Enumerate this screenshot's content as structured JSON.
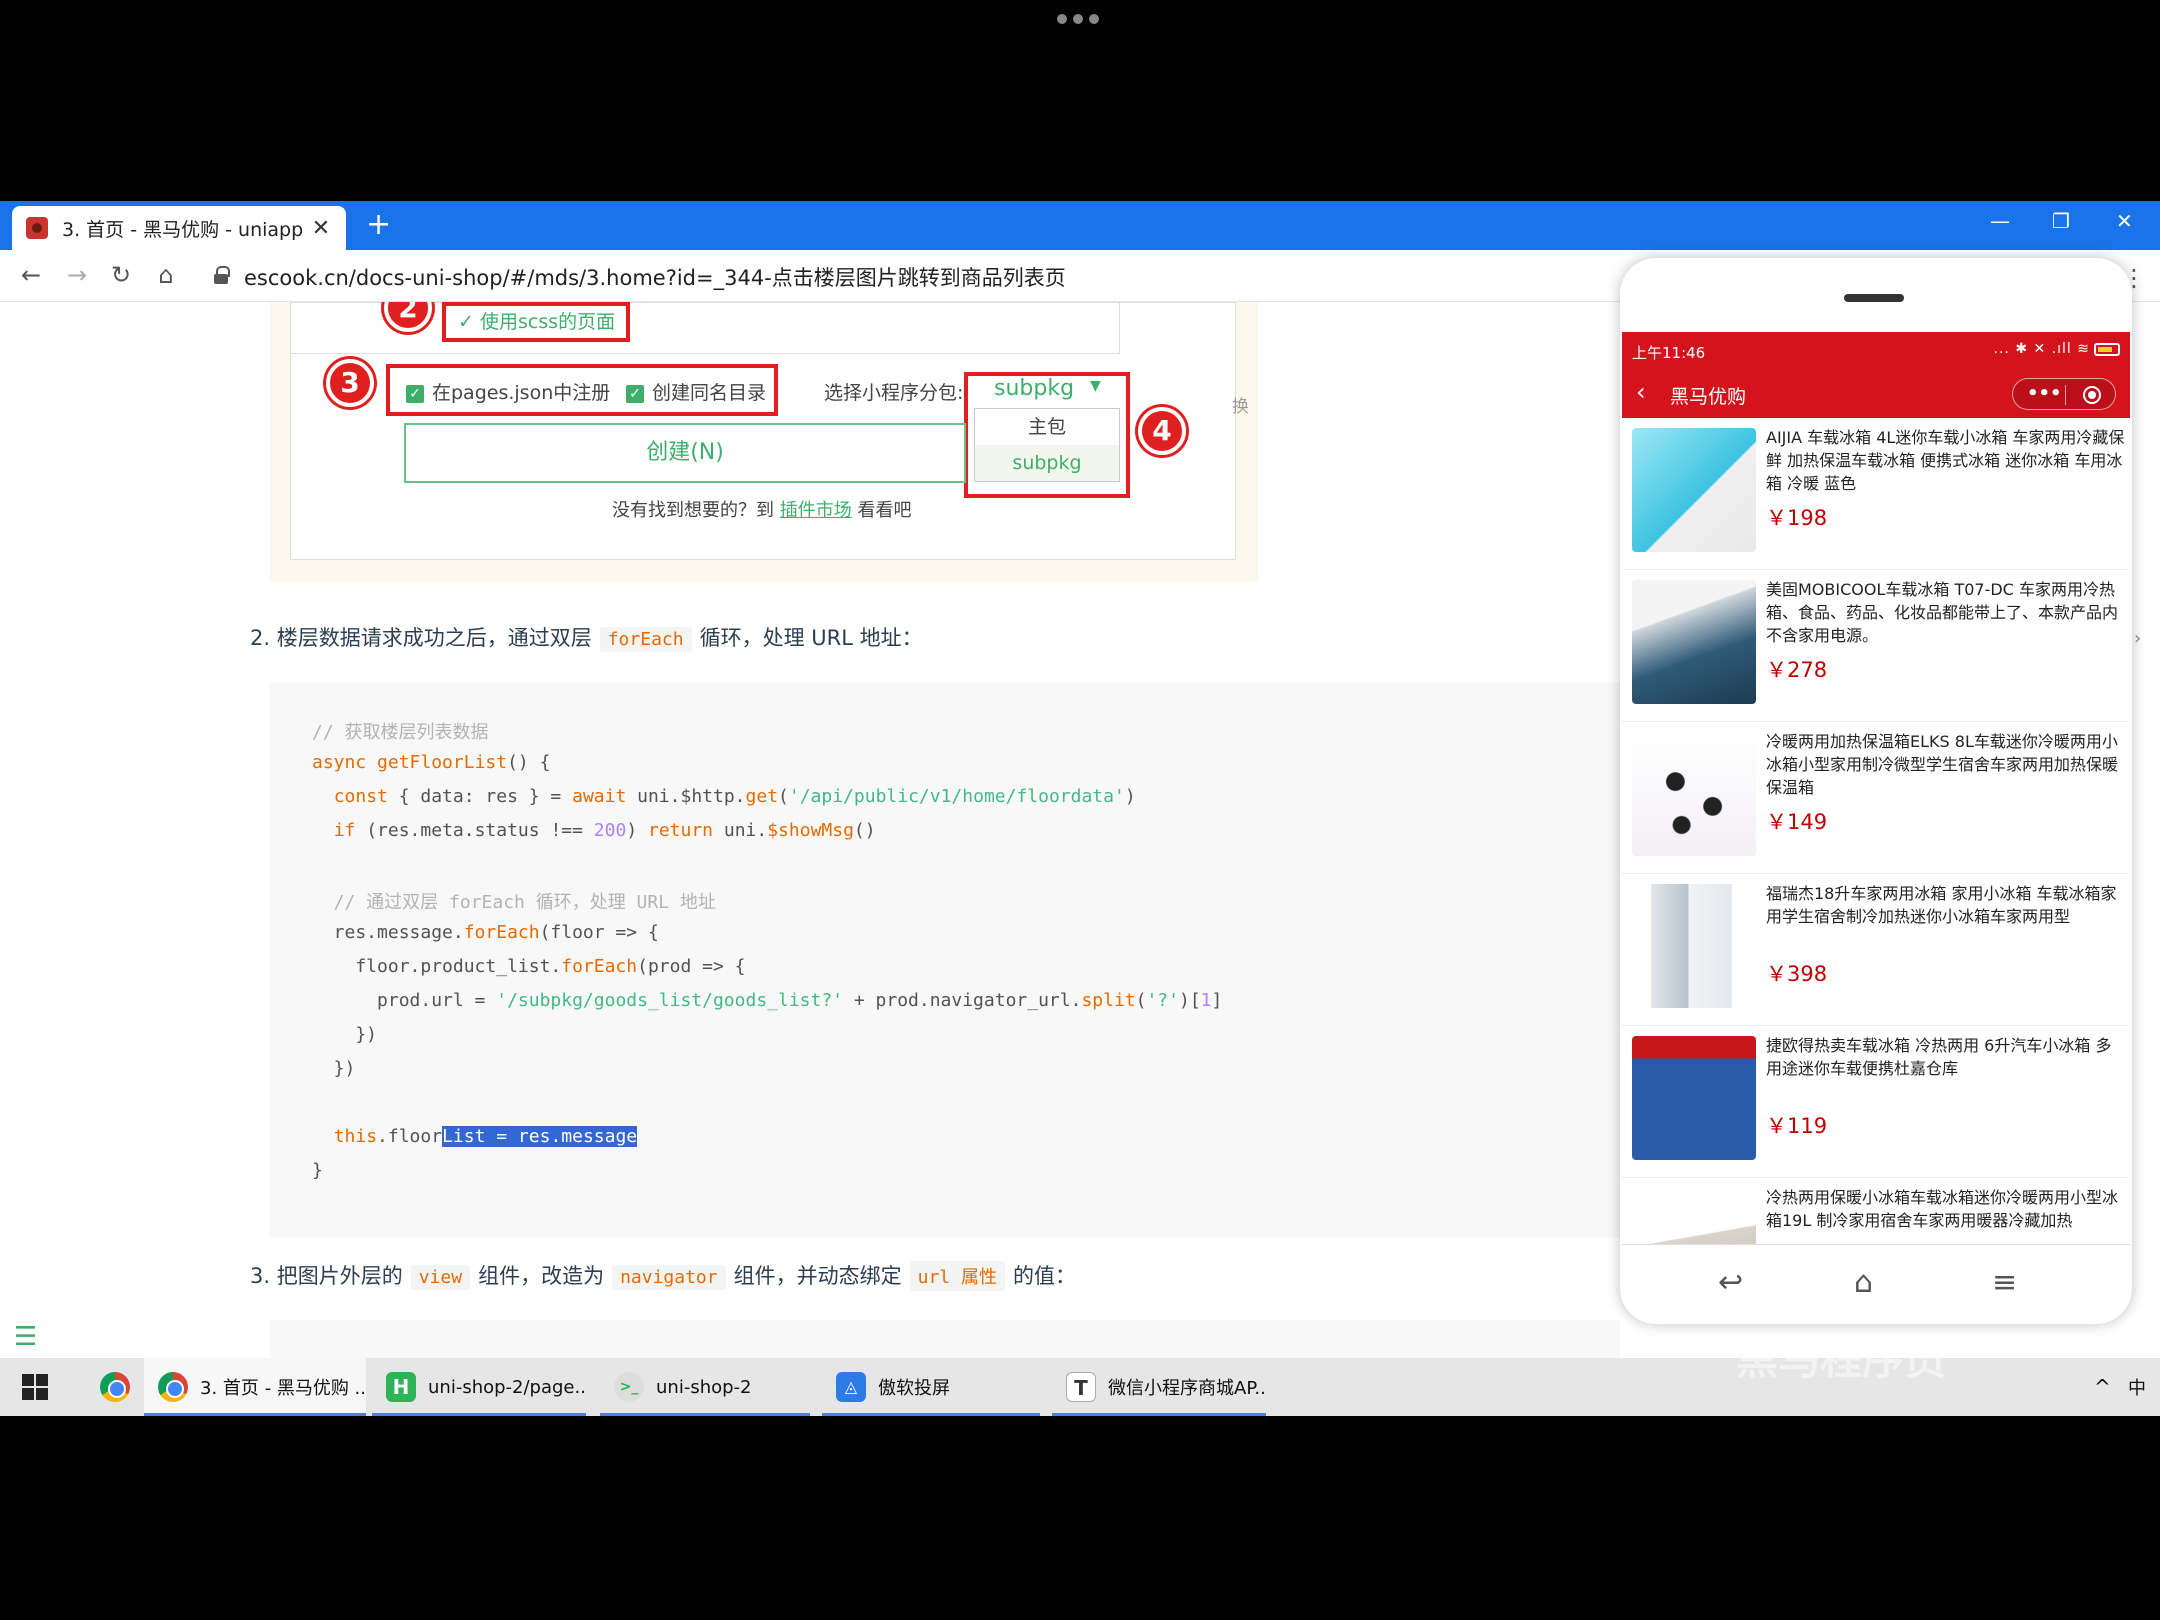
{
  "browser": {
    "tab_title": "3. 首页 - 黑马优购 - uniapp",
    "url": "escook.cn/docs-uni-shop/#/mds/3.home?id=_344-点击楼层图片跳转到商品列表页"
  },
  "screenshot_panel": {
    "badge2": "2",
    "badge3": "3",
    "badge4": "4",
    "scss_option": "使用scss的页面",
    "register_option": "在pages.json中注册",
    "same_dir_option": "创建同名目录",
    "subpkg_label": "选择小程序分包:",
    "subpkg_value": "subpkg",
    "dropdown_options": [
      "主包",
      "subpkg"
    ],
    "create_button": "创建(N)",
    "hint_prefix": "没有找到想要的？到",
    "hint_link": "插件市场",
    "hint_suffix": "看看吧",
    "edge_char": "换"
  },
  "step2": {
    "prefix": "2. 楼层数据请求成功之后，通过双层",
    "code": "forEach",
    "suffix": "循环，处理 URL 地址："
  },
  "code_lines": [
    "// 获取楼层列表数据",
    "async getFloorList() {",
    "  const { data: res } = await uni.$http.get('/api/public/v1/home/floordata')",
    "  if (res.meta.status !== 200) return uni.$showMsg()",
    "",
    "  // 通过双层 forEach 循环，处理 URL 地址",
    "  res.message.forEach(floor => {",
    "    floor.product_list.forEach(prod => {",
    "      prod.url = '/subpkg/goods_list/goods_list?' + prod.navigator_url.split('?')[1]",
    "    })",
    "  })",
    "",
    "  this.floorList = res.message",
    "}"
  ],
  "step3": {
    "prefix": "3. 把图片外层的",
    "code1": "view",
    "mid1": "组件，改造为",
    "code2": "navigator",
    "mid2": "组件，并动态绑定",
    "code3": "url 属性",
    "suffix": "的值："
  },
  "phone": {
    "status_time": "上午11:46",
    "status_icons": "... ✱ ✕ .ıll ≋",
    "title": "黑马优购",
    "capsule_more": "•••",
    "goods": [
      {
        "name": "AIJIA 车载冰箱 4L迷你车载小冰箱 车家两用冷藏保鲜 加热保温车载冰箱 便携式冰箱 迷你冰箱 车用冰箱 冷暖 蓝色",
        "price": "￥198"
      },
      {
        "name": "美固MOBICOOL车载冰箱 T07-DC 车家两用冷热箱、食品、药品、化妆品都能带上了、本款产品内不含家用电源。",
        "price": "￥278"
      },
      {
        "name": "冷暖两用加热保温箱ELKS 8L车载迷你冷暖两用小冰箱小型家用制冷微型学生宿舍车家两用加热保暖保温箱",
        "price": "￥149"
      },
      {
        "name": "福瑞杰18升车家两用冰箱 家用小冰箱 车载冰箱家用学生宿舍制冷加热迷你小冰箱车家两用型",
        "price": "￥398"
      },
      {
        "name": "捷欧得热卖车载冰箱 冷热两用 6升汽车小冰箱 多用途迷你车载便携杜嘉仓库",
        "price": "￥119"
      },
      {
        "name": "冷热两用保暖小冰箱车载冰箱迷你冷暖两用小型冰箱19L 制冷家用宿舍车家两用暖器冷藏加热",
        "price": ""
      }
    ]
  },
  "taskbar": {
    "items": [
      "3. 首页 - 黑马优购 ...",
      "uni-shop-2/page...",
      "uni-shop-2",
      "傲软投屏",
      "微信小程序商城AP..."
    ],
    "ime": "中"
  },
  "watermark": "黑马程序员"
}
